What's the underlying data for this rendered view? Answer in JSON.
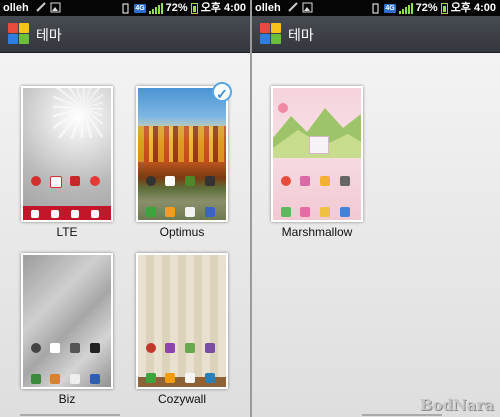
{
  "status_bar": {
    "carrier": "olleh",
    "network": "4G",
    "battery": "72%",
    "time": "오후 4:00"
  },
  "app": {
    "title": "테마"
  },
  "themes_left": [
    {
      "label": "LTE",
      "selected": false
    },
    {
      "label": "Optimus",
      "selected": true
    },
    {
      "label": "Biz",
      "selected": false
    },
    {
      "label": "Cozywall",
      "selected": false
    }
  ],
  "themes_right": [
    {
      "label": "Marshmallow",
      "selected": false
    }
  ],
  "watermark": "BodNara",
  "colors": {
    "accent": "#3a8ed6",
    "titlebar": "#3d4047",
    "signal": "#8fe04b"
  }
}
